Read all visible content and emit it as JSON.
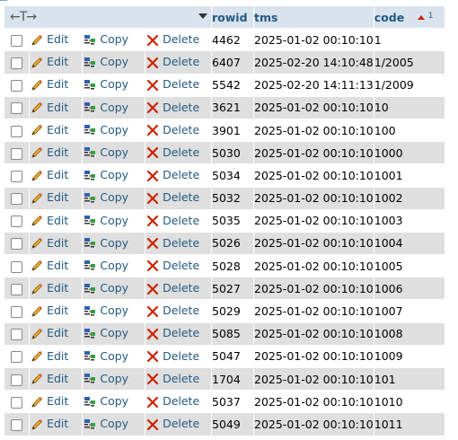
{
  "header": {
    "arrows": "←T→",
    "rowid_label": "rowid",
    "tms_label": "tms",
    "code_label": "code",
    "code_sort_index": "1"
  },
  "actions": {
    "edit": "Edit",
    "copy": "Copy",
    "delete": "Delete"
  },
  "colors": {
    "link": "#235a81",
    "header_bg": "#d8e3ee",
    "even_row": "#dfdfdf",
    "delete_x": "#cc2200"
  },
  "rows": [
    {
      "rowid": "4462",
      "tms": "2025-01-02 00:10:10",
      "code": "1"
    },
    {
      "rowid": "6407",
      "tms": "2025-02-20 14:10:48",
      "code": "1/2005"
    },
    {
      "rowid": "5542",
      "tms": "2025-02-20 14:11:13",
      "code": "1/2009"
    },
    {
      "rowid": "3621",
      "tms": "2025-01-02 00:10:10",
      "code": "10"
    },
    {
      "rowid": "3901",
      "tms": "2025-01-02 00:10:10",
      "code": "100"
    },
    {
      "rowid": "5030",
      "tms": "2025-01-02 00:10:10",
      "code": "1000"
    },
    {
      "rowid": "5034",
      "tms": "2025-01-02 00:10:10",
      "code": "1001"
    },
    {
      "rowid": "5032",
      "tms": "2025-01-02 00:10:10",
      "code": "1002"
    },
    {
      "rowid": "5035",
      "tms": "2025-01-02 00:10:10",
      "code": "1003"
    },
    {
      "rowid": "5026",
      "tms": "2025-01-02 00:10:10",
      "code": "1004"
    },
    {
      "rowid": "5028",
      "tms": "2025-01-02 00:10:10",
      "code": "1005"
    },
    {
      "rowid": "5027",
      "tms": "2025-01-02 00:10:10",
      "code": "1006"
    },
    {
      "rowid": "5029",
      "tms": "2025-01-02 00:10:10",
      "code": "1007"
    },
    {
      "rowid": "5085",
      "tms": "2025-01-02 00:10:10",
      "code": "1008"
    },
    {
      "rowid": "5047",
      "tms": "2025-01-02 00:10:10",
      "code": "1009"
    },
    {
      "rowid": "1704",
      "tms": "2025-01-02 00:10:10",
      "code": "101"
    },
    {
      "rowid": "5037",
      "tms": "2025-01-02 00:10:10",
      "code": "1010"
    },
    {
      "rowid": "5049",
      "tms": "2025-01-02 00:10:10",
      "code": "1011"
    }
  ]
}
